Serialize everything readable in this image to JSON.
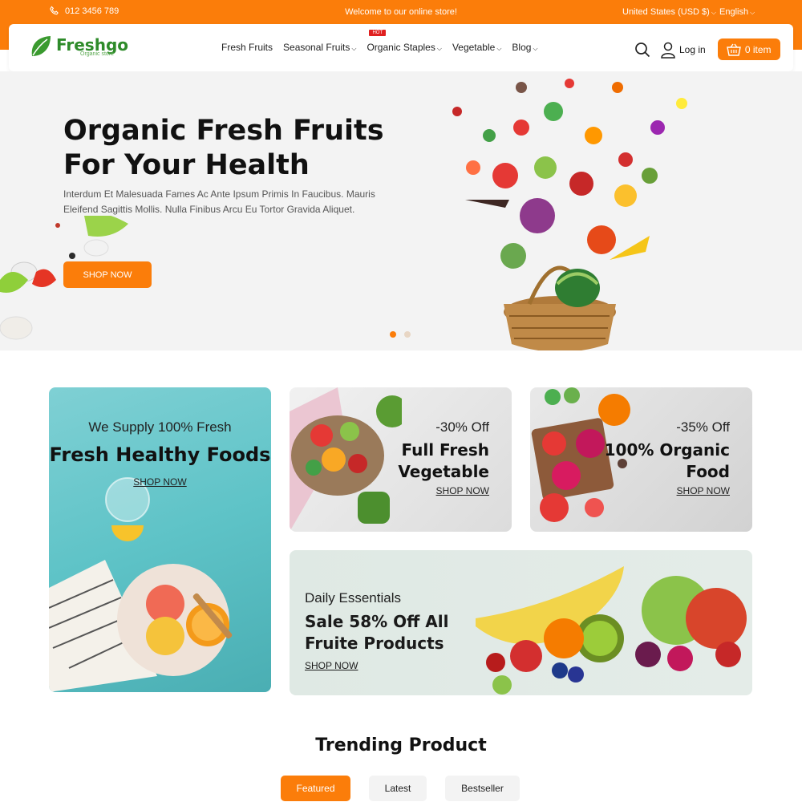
{
  "topbar": {
    "phone": "012 3456 789",
    "welcome": "Welcome to our online store!",
    "currency": "United States (USD $)",
    "language": "English"
  },
  "header": {
    "logo": "Freshgo",
    "logo_sub": "Organic store",
    "nav": [
      {
        "label": "Fresh Fruits"
      },
      {
        "label": "Seasonal Fruits"
      },
      {
        "label": "Organic Staples",
        "badge": "HOT"
      },
      {
        "label": "Vegetable"
      },
      {
        "label": "Blog"
      }
    ],
    "login": "Log in",
    "cart": "0 item"
  },
  "hero": {
    "title_line1": "Organic Fresh Fruits",
    "title_line2": "For Your Health",
    "description": "Interdum Et Malesuada Fames Ac Ante Ipsum Primis In Faucibus. Mauris Eleifend Sagittis Mollis. Nulla Finibus Arcu Eu Tortor Gravida Aliquet.",
    "button": "SHOP NOW"
  },
  "banners": {
    "b1": {
      "small": "We Supply 100% Fresh",
      "big": "Fresh Healthy Foods",
      "link": "SHOP NOW"
    },
    "b2": {
      "off": "-30% Off",
      "title1": "Full Fresh",
      "title2": "Vegetable",
      "link": "SHOP NOW"
    },
    "b3": {
      "off": "-35% Off",
      "title1": "100% Organic",
      "title2": "Food",
      "link": "SHOP NOW"
    },
    "b4": {
      "sub": "Daily Essentials",
      "title1": "Sale 58% Off All",
      "title2": "Fruite Products",
      "link": "SHOP NOW"
    }
  },
  "trending": {
    "title": "Trending Product",
    "tabs": [
      "Featured",
      "Latest",
      "Bestseller"
    ]
  },
  "colors": {
    "accent": "#fb7d0a",
    "brand": "#2e8b2a"
  }
}
